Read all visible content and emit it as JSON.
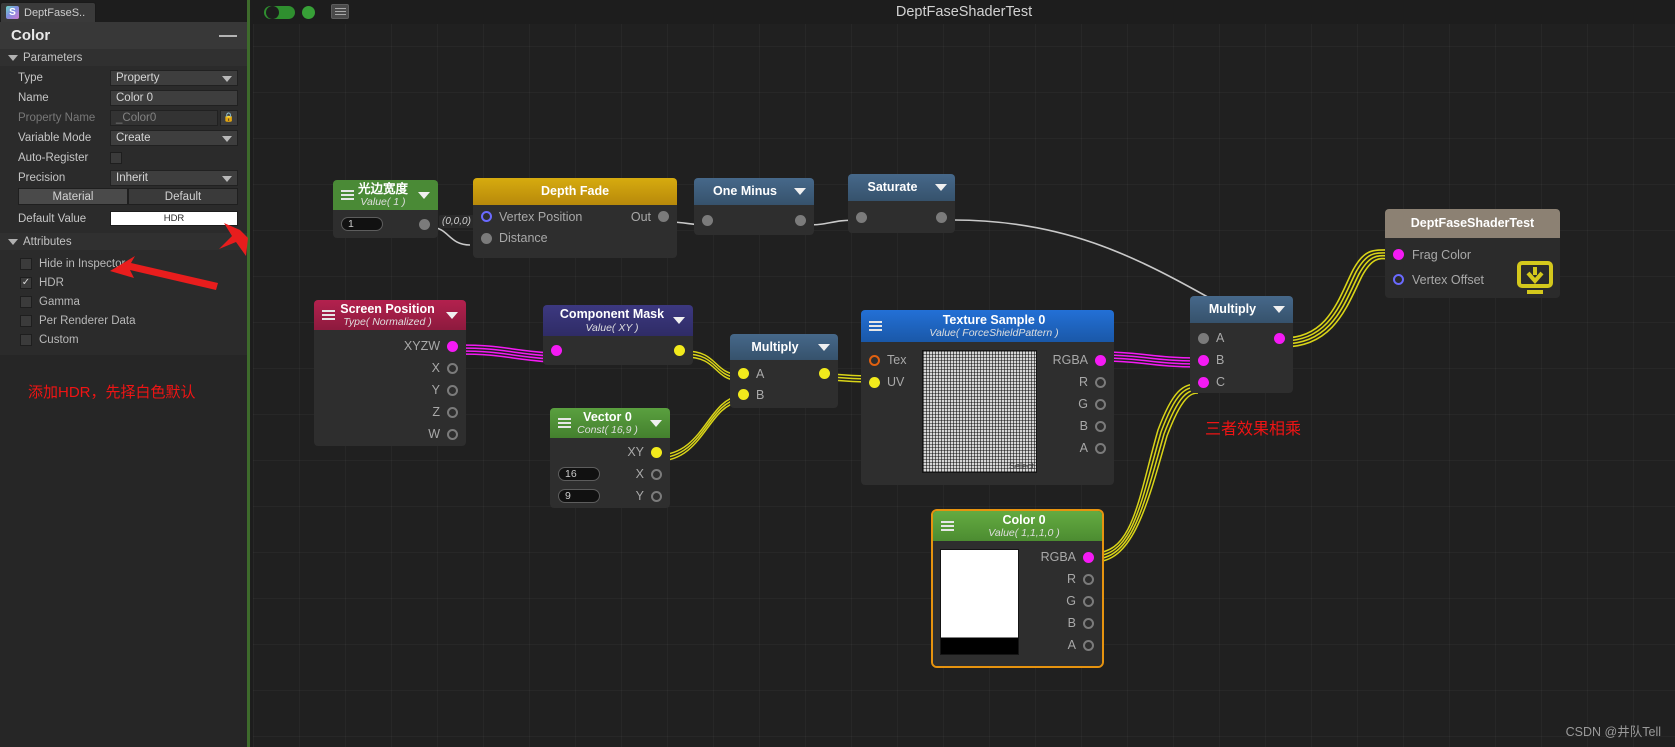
{
  "inspector": {
    "tab": {
      "label": "DeptFaseS..",
      "icon": "shader-graph-icon",
      "icon_letter": "S"
    },
    "panel_title": "Color",
    "minimize_icon": "minimize-icon",
    "sections": {
      "parameters": {
        "label": "Parameters",
        "expander_icon": "triangle-down-icon"
      },
      "attributes": {
        "label": "Attributes",
        "expander_icon": "triangle-down-icon"
      }
    },
    "rows": [
      {
        "label": "Type",
        "value": "Property",
        "kind": "dropdown"
      },
      {
        "label": "Name",
        "value": "Color 0",
        "kind": "text"
      },
      {
        "label": "Property Name",
        "value": "_Color0",
        "kind": "text-locked",
        "lock_icon": "lock-icon"
      },
      {
        "label": "Variable Mode",
        "value": "Create",
        "kind": "dropdown"
      },
      {
        "label": "Auto-Register",
        "value": "",
        "kind": "checkbox",
        "checked": false
      },
      {
        "label": "Precision",
        "value": "Inherit",
        "kind": "dropdown"
      }
    ],
    "segmented": {
      "options": [
        "Material",
        "Default"
      ],
      "selected": "Material"
    },
    "default_value": {
      "label": "Default Value",
      "swatch_text": "HDR",
      "swatch_color": "#ffffff"
    },
    "attributes": [
      {
        "label": "Hide in Inspector",
        "checked": false
      },
      {
        "label": "HDR",
        "checked": true
      },
      {
        "label": "Gamma",
        "checked": false
      },
      {
        "label": "Per Renderer Data",
        "checked": false
      },
      {
        "label": "Custom",
        "checked": false
      }
    ],
    "annotation": "添加HDR，先择白色默认"
  },
  "graph": {
    "title": "DeptFaseShaderTest",
    "watermark": "CSDN @井队Tell",
    "toolbar": {
      "pill_icon": "toggle-pill",
      "record_icon": "green-circle-icon",
      "screenshot_icon": "blackboard-icon"
    },
    "annotation_right": "三者效果相乘"
  },
  "nodes": {
    "light_width": {
      "title": "光边宽度",
      "subtitle": "Value( 1 )",
      "header_color": "#4a8a36",
      "value": "1",
      "out_port": {
        "label": "",
        "color": "grey"
      },
      "edge_label": "(0,0,0)"
    },
    "depth_fade": {
      "title": "Depth Fade",
      "header_color": "#caa311",
      "inputs": [
        {
          "label": "Vertex Position",
          "color": "ring-blue"
        },
        {
          "label": "Distance",
          "color": "grey"
        }
      ],
      "outputs": [
        {
          "label": "Out",
          "color": "grey"
        }
      ]
    },
    "one_minus": {
      "title": "One Minus",
      "header_color": "#3d5f7a",
      "inputs": [
        {
          "label": "",
          "color": "grey"
        }
      ],
      "outputs": [
        {
          "label": "",
          "color": "grey"
        }
      ]
    },
    "saturate": {
      "title": "Saturate",
      "header_color": "#3d5f7a",
      "inputs": [
        {
          "label": "",
          "color": "grey"
        }
      ],
      "outputs": [
        {
          "label": "",
          "color": "grey"
        }
      ]
    },
    "screen_position": {
      "title": "Screen Position",
      "subtitle": "Type( Normalized )",
      "header_color": "#a8204a",
      "outputs": [
        {
          "label": "XYZW",
          "color": "magenta"
        },
        {
          "label": "X",
          "color": "ring-grey"
        },
        {
          "label": "Y",
          "color": "ring-grey"
        },
        {
          "label": "Z",
          "color": "ring-grey"
        },
        {
          "label": "W",
          "color": "ring-grey"
        }
      ]
    },
    "component_mask": {
      "title": "Component Mask",
      "subtitle": "Value( XY )",
      "header_color": "#373371",
      "inputs": [
        {
          "label": "",
          "color": "magenta"
        }
      ],
      "outputs": [
        {
          "label": "",
          "color": "yellow"
        }
      ]
    },
    "multiply_left": {
      "title": "Multiply",
      "header_color": "#3d5f7a",
      "inputs": [
        {
          "label": "A",
          "color": "yellow"
        },
        {
          "label": "B",
          "color": "yellow"
        }
      ],
      "outputs": [
        {
          "label": "",
          "color": "yellow"
        }
      ]
    },
    "vector0": {
      "title": "Vector 0",
      "subtitle": "Const( 16,9 )",
      "header_color": "#4a8a36",
      "outputs": [
        {
          "label": "XY",
          "color": "yellow"
        },
        {
          "label": "X",
          "color": "ring-grey",
          "value": "16"
        },
        {
          "label": "Y",
          "color": "ring-grey",
          "value": "9"
        }
      ]
    },
    "texture_sample": {
      "title": "Texture Sample 0",
      "subtitle": "Value( ForceShieldPattern )",
      "header_color": "#1e62bd",
      "inputs": [
        {
          "label": "Tex",
          "color": "ring-orange"
        },
        {
          "label": "UV",
          "color": "yellow"
        }
      ],
      "outputs": [
        {
          "label": "RGBA",
          "color": "magenta"
        },
        {
          "label": "R",
          "color": "ring-grey"
        },
        {
          "label": "G",
          "color": "ring-grey"
        },
        {
          "label": "B",
          "color": "ring-grey"
        },
        {
          "label": "A",
          "color": "ring-grey"
        }
      ],
      "preview_caption": "Select"
    },
    "color0": {
      "title": "Color 0",
      "subtitle": "Value( 1,1,1,0 )",
      "header_color": "#589d36",
      "border_color": "#e6930f",
      "outputs": [
        {
          "label": "RGBA",
          "color": "magenta"
        },
        {
          "label": "R",
          "color": "ring-grey"
        },
        {
          "label": "G",
          "color": "ring-grey"
        },
        {
          "label": "B",
          "color": "ring-grey"
        },
        {
          "label": "A",
          "color": "ring-grey"
        }
      ],
      "swatch_top": "#ffffff",
      "swatch_bottom": "#000000"
    },
    "multiply_right": {
      "title": "Multiply",
      "header_color": "#3d5f7a",
      "inputs": [
        {
          "label": "A",
          "color": "grey"
        },
        {
          "label": "B",
          "color": "magenta"
        },
        {
          "label": "C",
          "color": "magenta"
        }
      ],
      "outputs": [
        {
          "label": "",
          "color": "magenta"
        }
      ]
    },
    "master": {
      "title": "DeptFaseShaderTest",
      "header_color": "#8a7e6d",
      "inputs": [
        {
          "label": "Frag Color",
          "color": "magenta"
        },
        {
          "label": "Vertex Offset",
          "color": "ring-blue"
        }
      ],
      "download_icon": "download-icon"
    }
  }
}
